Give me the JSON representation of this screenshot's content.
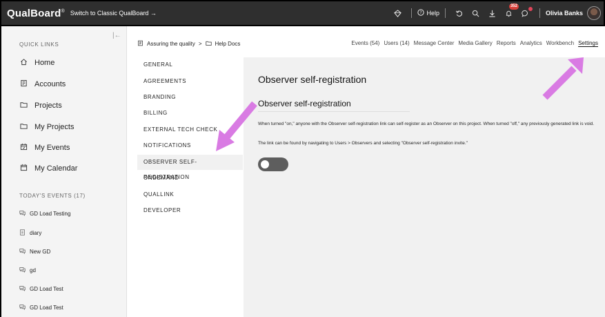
{
  "topbar": {
    "brand": "QualBoard",
    "brand_mark": "®",
    "switch_link": "Switch to Classic QualBoard →",
    "help_label": "Help",
    "notification_count": "352",
    "user_name": "Olivia Banks",
    "icons": [
      "diamond-icon",
      "help-icon",
      "refresh-icon",
      "search-icon",
      "download-icon",
      "bell-icon",
      "chat-icon"
    ]
  },
  "sidebar": {
    "quick_links_title": "QUICK LINKS",
    "items": [
      {
        "label": "Home",
        "icon": "home-icon"
      },
      {
        "label": "Accounts",
        "icon": "accounts-icon"
      },
      {
        "label": "Projects",
        "icon": "folder-icon"
      },
      {
        "label": "My Projects",
        "icon": "folder-icon"
      },
      {
        "label": "My Events",
        "icon": "calendar-check-icon"
      },
      {
        "label": "My Calendar",
        "icon": "calendar-icon"
      }
    ],
    "todays_events_title": "TODAY'S EVENTS (17)",
    "events": [
      {
        "label": "GD Load Testing",
        "icon": "chat-bubbles-icon"
      },
      {
        "label": "diary",
        "icon": "diary-icon"
      },
      {
        "label": "New GD",
        "icon": "chat-bubbles-icon"
      },
      {
        "label": "gd",
        "icon": "chat-bubbles-icon"
      },
      {
        "label": "GD Load Test",
        "icon": "chat-bubbles-icon"
      },
      {
        "label": "GD Load Test",
        "icon": "chat-bubbles-icon"
      }
    ]
  },
  "breadcrumb": {
    "account": "Assuring the quality",
    "separator": ">",
    "project": "Help Docs"
  },
  "tabs": [
    "Events (54)",
    "Users (14)",
    "Message Center",
    "Media Gallery",
    "Reports",
    "Analytics",
    "Workbench",
    "Settings"
  ],
  "active_tab": "Settings",
  "settings_menu": [
    "GENERAL",
    "AGREEMENTS",
    "BRANDING",
    "BILLING",
    "EXTERNAL TECH CHECK",
    "NOTIFICATIONS",
    "OBSERVER SELF-REGISTRATION",
    "ONDEMAND",
    "QUALLINK",
    "DEVELOPER"
  ],
  "active_menu": "OBSERVER SELF-REGISTRATION",
  "content": {
    "title": "Observer self-registration",
    "subtitle": "Observer self-registration",
    "description": "When turned \"on,\" anyone with the Observer self-registration link can self-register as an Observer on this project. When turned \"off,\" any previously generated link is void.",
    "description2": "The link can be found by navigating to Users > Observers and selecting \"Observer self-registration invite.\"",
    "toggle_on": false
  },
  "colors": {
    "topbar": "#2f2f2f",
    "annotation_arrow": "#d97be3",
    "toggle_off": "#5e5e5e",
    "badge": "#d9403a"
  }
}
